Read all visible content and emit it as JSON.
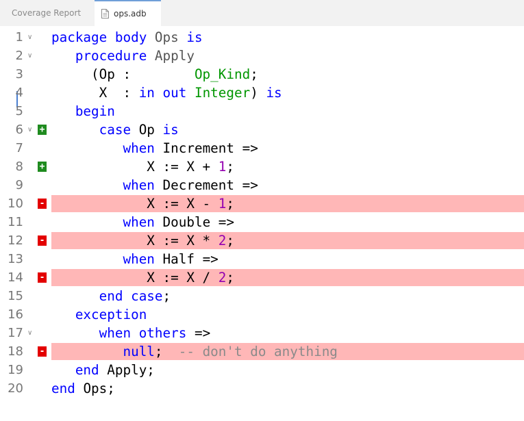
{
  "tabs": [
    {
      "label": "Coverage Report",
      "active": false
    },
    {
      "label": "ops.adb",
      "active": true,
      "icon": "file-icon"
    }
  ],
  "colors": {
    "keyword": "#0000ff",
    "type": "#009600",
    "number": "#9400b0",
    "comment": "#8a8a8a",
    "covered_marker": "#1f8b1f",
    "uncovered_marker": "#e30000",
    "uncovered_highlight": "#ffb7b7"
  },
  "lines": [
    {
      "n": "1",
      "fold": true,
      "tokens": [
        [
          "kw",
          "package body "
        ],
        [
          "id",
          "Ops "
        ],
        [
          "kw",
          "is"
        ]
      ]
    },
    {
      "n": "2",
      "fold": true,
      "tokens": [
        [
          "",
          "   "
        ],
        [
          "kw",
          "procedure "
        ],
        [
          "id",
          "Apply"
        ]
      ]
    },
    {
      "n": "3",
      "tokens": [
        [
          "",
          "     (Op :        "
        ],
        [
          "ty",
          "Op_Kind"
        ],
        [
          "",
          ";"
        ]
      ]
    },
    {
      "n": "4",
      "tokens": [
        [
          "",
          "      X  : "
        ],
        [
          "kw",
          "in out "
        ],
        [
          "ty",
          "Integer"
        ],
        [
          "",
          ") "
        ],
        [
          "kw",
          "is"
        ]
      ]
    },
    {
      "n": "5",
      "tokens": [
        [
          "",
          "   "
        ],
        [
          "kw",
          "begin"
        ]
      ]
    },
    {
      "n": "6",
      "fold": true,
      "cov": "+",
      "tokens": [
        [
          "",
          "      "
        ],
        [
          "kw",
          "case "
        ],
        [
          "",
          "Op "
        ],
        [
          "kw",
          "is"
        ]
      ]
    },
    {
      "n": "7",
      "tokens": [
        [
          "",
          "         "
        ],
        [
          "kw",
          "when "
        ],
        [
          "",
          "Increment =>"
        ]
      ]
    },
    {
      "n": "8",
      "cov": "+",
      "tokens": [
        [
          "",
          "            X := X + "
        ],
        [
          "nm",
          "1"
        ],
        [
          "",
          ";"
        ]
      ]
    },
    {
      "n": "9",
      "tokens": [
        [
          "",
          "         "
        ],
        [
          "kw",
          "when "
        ],
        [
          "",
          "Decrement =>"
        ]
      ]
    },
    {
      "n": "10",
      "cov": "-",
      "tokens": [
        [
          "",
          "            X := X - "
        ],
        [
          "nm",
          "1"
        ],
        [
          "",
          ";"
        ]
      ]
    },
    {
      "n": "11",
      "tokens": [
        [
          "",
          "         "
        ],
        [
          "kw",
          "when "
        ],
        [
          "",
          "Double =>"
        ]
      ]
    },
    {
      "n": "12",
      "cov": "-",
      "tokens": [
        [
          "",
          "            X := X * "
        ],
        [
          "nm",
          "2"
        ],
        [
          "",
          ";"
        ]
      ]
    },
    {
      "n": "13",
      "tokens": [
        [
          "",
          "         "
        ],
        [
          "kw",
          "when "
        ],
        [
          "",
          "Half =>"
        ]
      ]
    },
    {
      "n": "14",
      "cov": "-",
      "tokens": [
        [
          "",
          "            X := X / "
        ],
        [
          "nm",
          "2"
        ],
        [
          "",
          ";"
        ]
      ]
    },
    {
      "n": "15",
      "tokens": [
        [
          "",
          "      "
        ],
        [
          "kw",
          "end case"
        ],
        [
          "",
          ";"
        ]
      ]
    },
    {
      "n": "16",
      "tokens": [
        [
          "",
          "   "
        ],
        [
          "kw",
          "exception"
        ]
      ]
    },
    {
      "n": "17",
      "fold": true,
      "tokens": [
        [
          "",
          "      "
        ],
        [
          "kw",
          "when others "
        ],
        [
          "",
          "=>"
        ]
      ]
    },
    {
      "n": "18",
      "cov": "-",
      "tokens": [
        [
          "",
          "         "
        ],
        [
          "kw",
          "null"
        ],
        [
          "",
          ";  "
        ],
        [
          "cm",
          "-- don't do anything"
        ]
      ]
    },
    {
      "n": "19",
      "tokens": [
        [
          "",
          "   "
        ],
        [
          "kw",
          "end "
        ],
        [
          "",
          "Apply;"
        ]
      ]
    },
    {
      "n": "20",
      "tokens": [
        [
          "kw",
          "end "
        ],
        [
          "",
          "Ops;"
        ]
      ]
    }
  ]
}
